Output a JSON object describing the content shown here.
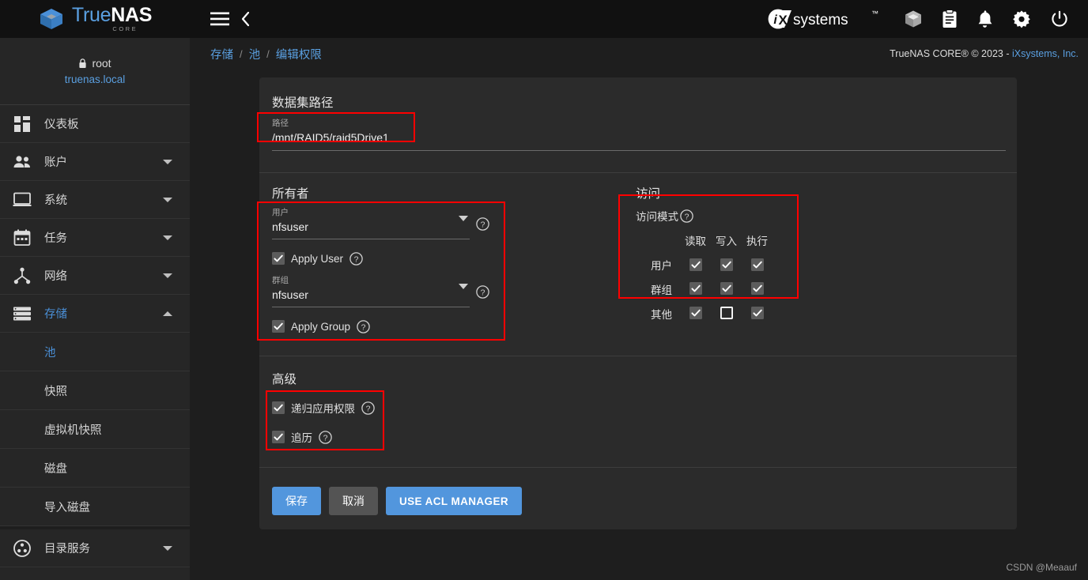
{
  "brand": {
    "name_part1": "True",
    "name_part2": "NAS",
    "subtitle": "CORE",
    "logo_icon": "truenas-cube-logo"
  },
  "user_panel": {
    "lock_icon": "lock-icon",
    "username": "root",
    "hostname": "truenas.local"
  },
  "sidebar": {
    "items": [
      {
        "label": "仪表板",
        "icon": "dashboard-icon",
        "expandable": false,
        "active": false
      },
      {
        "label": "账户",
        "icon": "accounts-people-icon",
        "expandable": true,
        "active": false
      },
      {
        "label": "系统",
        "icon": "system-monitor-icon",
        "expandable": true,
        "active": false
      },
      {
        "label": "任务",
        "icon": "tasks-calendar-icon",
        "expandable": true,
        "active": false
      },
      {
        "label": "网络",
        "icon": "network-icon",
        "expandable": true,
        "active": false
      },
      {
        "label": "存储",
        "icon": "storage-list-icon",
        "expandable": true,
        "active": true,
        "expanded": true
      }
    ],
    "storage_children": [
      {
        "label": "池",
        "active": true
      },
      {
        "label": "快照",
        "active": false
      },
      {
        "label": "虚拟机快照",
        "active": false
      },
      {
        "label": "磁盘",
        "active": false
      },
      {
        "label": "导入磁盘",
        "active": false
      }
    ],
    "items_after": [
      {
        "label": "目录服务",
        "icon": "directory-services-icon",
        "expandable": true,
        "active": false
      }
    ]
  },
  "topbar": {
    "menu_icon": "hamburger-menu-icon",
    "back_icon": "chevron-left-icon",
    "ix_logo": "ixsystems-logo",
    "ix_text": "systems",
    "actions": [
      {
        "icon": "cube-jobs-icon",
        "name": "jobs-button"
      },
      {
        "icon": "clipboard-tasks-icon",
        "name": "tasks-button"
      },
      {
        "icon": "bell-alerts-icon",
        "name": "alerts-button"
      },
      {
        "icon": "gear-settings-icon",
        "name": "settings-button"
      },
      {
        "icon": "power-icon",
        "name": "power-button"
      }
    ]
  },
  "breadcrumb": {
    "items": [
      "存储",
      "池",
      "编辑权限"
    ],
    "separator": "/"
  },
  "copyright": {
    "text": "TrueNAS CORE® © 2023 - ",
    "link": "iXsystems, Inc."
  },
  "form": {
    "dataset_section": {
      "title": "数据集路径",
      "path_label": "路径",
      "path_value": "/mnt/RAID5/raid5Drive1"
    },
    "owner_section": {
      "title": "所有者",
      "user_label": "用户",
      "user_value": "nfsuser",
      "apply_user_label": "Apply User",
      "apply_user_checked": true,
      "group_label": "群组",
      "group_value": "nfsuser",
      "apply_group_label": "Apply Group",
      "apply_group_checked": true,
      "help_icon": "help-circle-icon",
      "dropdown_icon": "caret-down-icon"
    },
    "access_section": {
      "title": "访问",
      "mode_label": "访问模式",
      "help_icon": "help-circle-icon",
      "columns": [
        "读取",
        "写入",
        "执行"
      ],
      "rows": [
        {
          "label": "用户",
          "values": [
            true,
            true,
            true
          ]
        },
        {
          "label": "群组",
          "values": [
            true,
            true,
            true
          ]
        },
        {
          "label": "其他",
          "values": [
            true,
            false,
            true
          ]
        }
      ]
    },
    "advanced_section": {
      "title": "高级",
      "options": [
        {
          "label": "递归应用权限",
          "checked": true,
          "help_icon": "help-circle-icon"
        },
        {
          "label": "追历",
          "checked": true,
          "help_icon": "help-circle-icon"
        }
      ]
    },
    "buttons": [
      {
        "label": "保存",
        "style": "primary",
        "name": "save-button"
      },
      {
        "label": "取消",
        "style": "plain",
        "name": "cancel-button"
      },
      {
        "label": "USE ACL MANAGER",
        "style": "primary-caps",
        "name": "use-acl-manager-button"
      }
    ]
  },
  "colors": {
    "accent_blue": "#5a9fe0",
    "button_blue": "#5296dd",
    "highlight_red": "#ff0000",
    "page_bg": "#1e1e1e",
    "card_bg": "#2b2b2b",
    "sidebar_bg": "#262626",
    "topbar_bg": "#111111"
  },
  "watermark": {
    "text": "CSDN @Meaauf"
  }
}
